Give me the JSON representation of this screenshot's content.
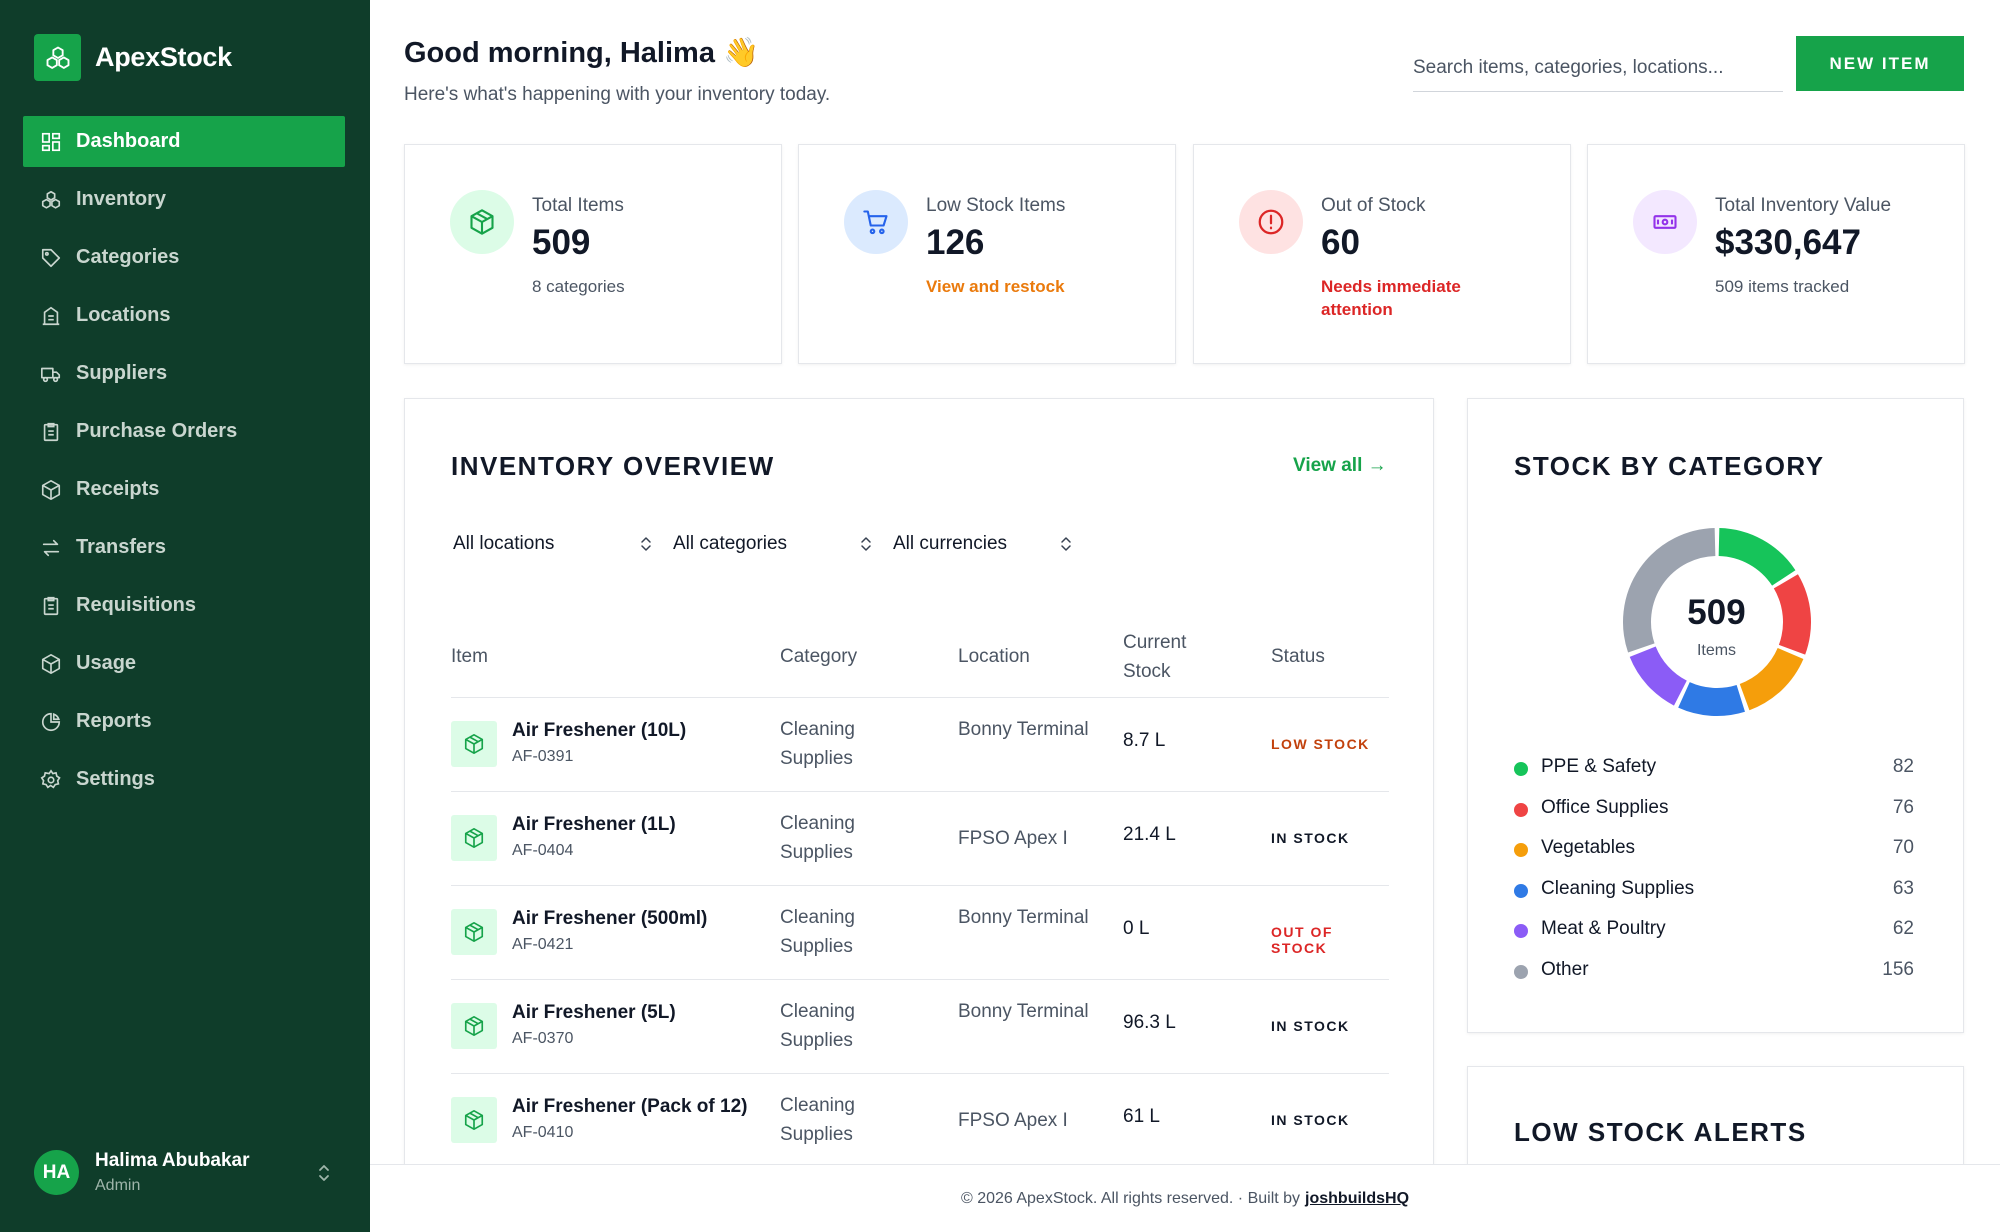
{
  "app": {
    "name": "ApexStock",
    "accent": "#16a34a",
    "sidebar_bg": "#0f3d2a"
  },
  "sidebar": {
    "items": [
      {
        "label": "Dashboard",
        "icon": "dashboard-icon",
        "active": true
      },
      {
        "label": "Inventory",
        "icon": "inventory-icon"
      },
      {
        "label": "Categories",
        "icon": "tag-icon"
      },
      {
        "label": "Locations",
        "icon": "building-icon"
      },
      {
        "label": "Suppliers",
        "icon": "truck-icon"
      },
      {
        "label": "Purchase Orders",
        "icon": "clipboard-icon"
      },
      {
        "label": "Receipts",
        "icon": "package-icon"
      },
      {
        "label": "Transfers",
        "icon": "transfer-icon"
      },
      {
        "label": "Requisitions",
        "icon": "clipboard-icon"
      },
      {
        "label": "Usage",
        "icon": "package-icon"
      },
      {
        "label": "Reports",
        "icon": "pie-chart-icon"
      },
      {
        "label": "Settings",
        "icon": "gear-icon"
      }
    ],
    "user": {
      "initials": "HA",
      "name": "Halima Abubakar",
      "role": "Admin"
    }
  },
  "header": {
    "greeting": "Good morning, Halima 👋",
    "subtitle": "Here's what's happening with your inventory today.",
    "search_placeholder": "Search items, categories, locations...",
    "new_item_label": "NEW ITEM"
  },
  "stats": [
    {
      "label": "Total Items",
      "value": "509",
      "sub": "8 categories",
      "icon": "box-icon",
      "color": "#16a34a",
      "bg": "#dcfce7"
    },
    {
      "label": "Low Stock Items",
      "value": "126",
      "sub": "View and restock",
      "icon": "cart-icon",
      "color": "#2563eb",
      "bg": "#dbeafe"
    },
    {
      "label": "Out of Stock",
      "value": "60",
      "sub": "Needs immediate attention",
      "icon": "alert-icon",
      "color": "#dc2626",
      "bg": "#fee2e2"
    },
    {
      "label": "Total Inventory Value",
      "value": "$330,647",
      "sub": "509 items tracked",
      "icon": "cash-icon",
      "color": "#9333ea",
      "bg": "#f3e8ff"
    }
  ],
  "overview": {
    "title": "INVENTORY OVERVIEW",
    "view_all": "View all →",
    "filters": [
      "All locations",
      "All categories",
      "All currencies"
    ],
    "columns": [
      "Item",
      "Category",
      "Location",
      "Current Stock",
      "Status"
    ],
    "rows": [
      {
        "name": "Air Freshener (10L)",
        "code": "AF-0391",
        "category": "Cleaning Supplies",
        "location": "Bonny Terminal",
        "stock": "8.7 L",
        "status": "LOW STOCK",
        "status_kind": "low"
      },
      {
        "name": "Air Freshener (1L)",
        "code": "AF-0404",
        "category": "Cleaning Supplies",
        "location": "FPSO Apex I",
        "stock": "21.4 L",
        "status": "IN STOCK",
        "status_kind": "in"
      },
      {
        "name": "Air Freshener (500ml)",
        "code": "AF-0421",
        "category": "Cleaning Supplies",
        "location": "Bonny Terminal",
        "stock": "0 L",
        "status": "OUT OF STOCK",
        "status_kind": "out"
      },
      {
        "name": "Air Freshener (5L)",
        "code": "AF-0370",
        "category": "Cleaning Supplies",
        "location": "Bonny Terminal",
        "stock": "96.3 L",
        "status": "IN STOCK",
        "status_kind": "in"
      },
      {
        "name": "Air Freshener (Pack of 12)",
        "code": "AF-0410",
        "category": "Cleaning Supplies",
        "location": "FPSO Apex I",
        "stock": "61 L",
        "status": "IN STOCK",
        "status_kind": "in"
      }
    ]
  },
  "stock_by_category": {
    "title": "STOCK BY CATEGORY",
    "total": "509",
    "total_label": "Items",
    "categories": [
      {
        "name": "PPE & Safety",
        "value": 82,
        "color": "#16c45a"
      },
      {
        "name": "Office Supplies",
        "value": 76,
        "color": "#ef4444"
      },
      {
        "name": "Vegetables",
        "value": 70,
        "color": "#f59e0b"
      },
      {
        "name": "Cleaning Supplies",
        "value": 63,
        "color": "#2f7ae5"
      },
      {
        "name": "Meat & Poultry",
        "value": 62,
        "color": "#8b5cf6"
      },
      {
        "name": "Other",
        "value": 156,
        "color": "#9ca3af"
      }
    ]
  },
  "low_stock_alerts": {
    "title": "LOW STOCK ALERTS"
  },
  "footer": {
    "text": "© 2026 ApexStock. All rights reserved. · Built by",
    "link": "joshbuildsHQ"
  }
}
